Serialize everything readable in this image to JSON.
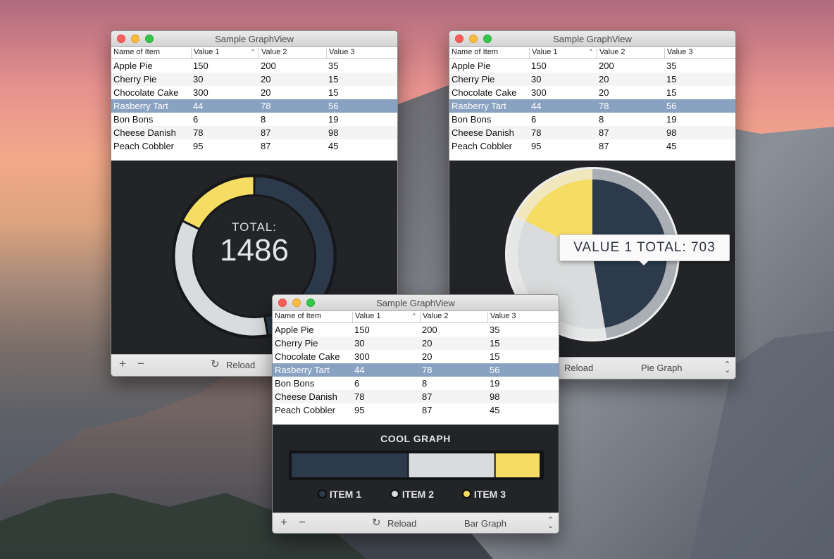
{
  "windows": [
    {
      "title": "Sample GraphView",
      "graph_type": "donut",
      "total_label": "TOTAL:",
      "total_value": "1486",
      "bottom": {
        "reload_label": "Reload"
      }
    },
    {
      "title": "Sample GraphView",
      "graph_type": "pie",
      "tooltip": "VALUE 1 TOTAL: 703",
      "bottom": {
        "reload_label": "Reload",
        "graph_select": "Pie Graph"
      }
    },
    {
      "title": "Sample GraphView",
      "graph_type": "bar",
      "graph_title": "COOL GRAPH",
      "legend": [
        "ITEM 1",
        "ITEM 2",
        "ITEM 3"
      ],
      "bottom": {
        "reload_label": "Reload",
        "graph_select": "Bar Graph"
      }
    }
  ],
  "table": {
    "headers": [
      "Name of Item",
      "Value 1",
      "Value 2",
      "Value 3"
    ],
    "sort_column": 1,
    "selected_row": 3,
    "rows": [
      [
        "Apple Pie",
        "150",
        "200",
        "35"
      ],
      [
        "Cherry Pie",
        "30",
        "20",
        "15"
      ],
      [
        "Chocolate Cake",
        "300",
        "20",
        "15"
      ],
      [
        "Rasberry Tart",
        "44",
        "78",
        "56"
      ],
      [
        "Bon Bons",
        "6",
        "8",
        "19"
      ],
      [
        "Cheese Danish",
        "78",
        "87",
        "98"
      ],
      [
        "Peach Cobbler",
        "95",
        "87",
        "45"
      ]
    ]
  },
  "colors": {
    "item1": "#2c3a4b",
    "item2": "#d9dbdc",
    "item3": "#f5dc63",
    "graph_bg": "#232428",
    "selection": "#8aa2c1"
  },
  "chart_data": [
    {
      "type": "pie",
      "style": "donut",
      "categories": [
        "ITEM 1",
        "ITEM 2",
        "ITEM 3"
      ],
      "values": [
        703,
        520,
        263
      ]
    },
    {
      "type": "pie",
      "categories": [
        "ITEM 1",
        "ITEM 2",
        "ITEM 3"
      ],
      "values": [
        703,
        520,
        263
      ]
    },
    {
      "type": "bar",
      "style": "stacked-horizontal",
      "categories": [
        "ITEM 1",
        "ITEM 2",
        "ITEM 3"
      ],
      "values": [
        703,
        520,
        263
      ],
      "title": "COOL GRAPH"
    }
  ]
}
